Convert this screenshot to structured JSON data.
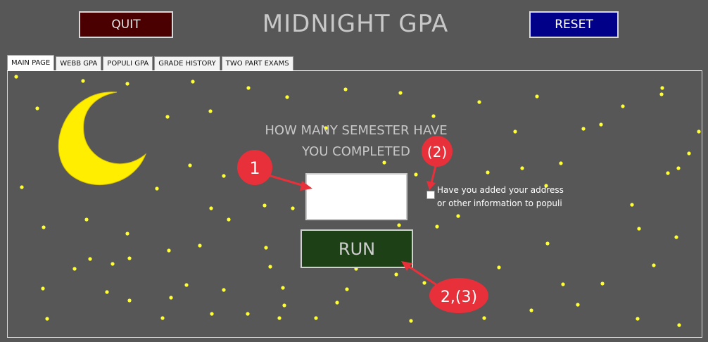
{
  "header": {
    "quit_label": "QUIT",
    "title": "MIDNIGHT GPA",
    "reset_label": "RESET"
  },
  "tabs": [
    {
      "label": "MAIN PAGE",
      "active": true
    },
    {
      "label": "WEBB GPA",
      "active": false
    },
    {
      "label": "POPULI GPA",
      "active": false
    },
    {
      "label": "GRADE HISTORY",
      "active": false
    },
    {
      "label": "TWO PART EXAMS",
      "active": false
    }
  ],
  "main": {
    "question_line1": "HOW MANY SEMESTER HAVE",
    "question_line2": "YOU COMPLETED",
    "semesters_value": "",
    "address_label_line1": "Have you added your address",
    "address_label_line2": "or other information to populi",
    "address_checked": false,
    "run_label": "RUN"
  },
  "annotations": {
    "marker1": "1",
    "marker2": "(2)",
    "marker3": "2,(3)",
    "color": "#e8303a"
  },
  "colors": {
    "background": "#575757",
    "star": "#ffff33",
    "moon": "#ffee00",
    "quit_bg": "#4a0000",
    "reset_bg": "#000088",
    "run_bg": "#1e4016"
  }
}
